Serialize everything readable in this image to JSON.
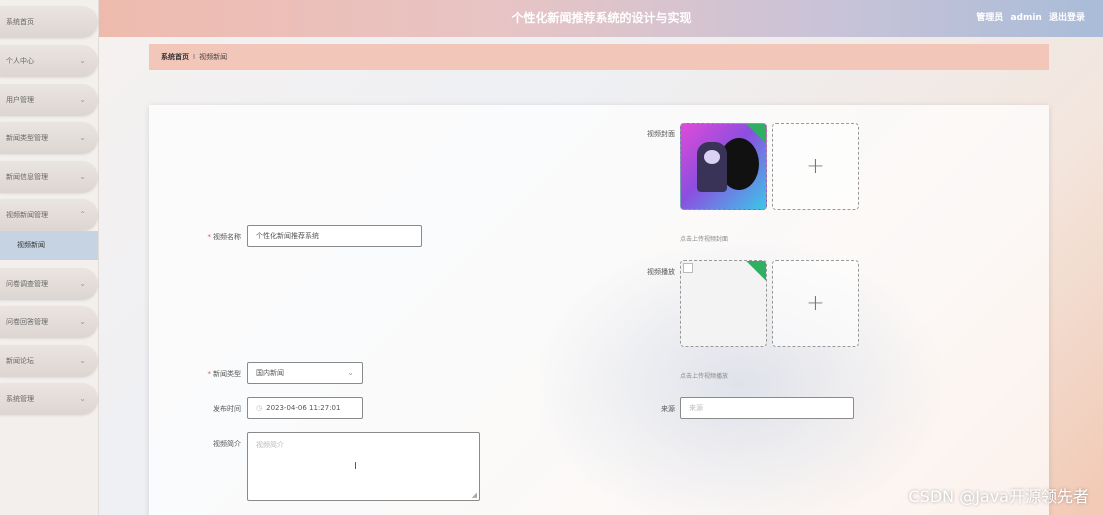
{
  "header": {
    "title": "个性化新闻推荐系统的设计与实现",
    "user_role": "管理员",
    "username": "admin",
    "logout_label": "退出登录"
  },
  "sidebar": {
    "items": [
      {
        "label": "系统首页",
        "chevron": ""
      },
      {
        "label": "个人中心",
        "chevron": "⌄"
      },
      {
        "label": "用户管理",
        "chevron": "⌄"
      },
      {
        "label": "新闻类型管理",
        "chevron": "⌄"
      },
      {
        "label": "新闻信息管理",
        "chevron": "⌄"
      },
      {
        "label": "视频新闻管理",
        "chevron": "⌃"
      },
      {
        "label": "问卷调查管理",
        "chevron": "⌄"
      },
      {
        "label": "问卷回答管理",
        "chevron": "⌄"
      },
      {
        "label": "新闻论坛",
        "chevron": "⌄"
      },
      {
        "label": "系统管理",
        "chevron": "⌄"
      }
    ],
    "active_sub_item": "视频新闻"
  },
  "breadcrumb": {
    "home": "系统首页",
    "separator": "I",
    "current": "视频新闻"
  },
  "form": {
    "video_name": {
      "label": "视频名称",
      "value": "个性化新闻推荐系统"
    },
    "news_type": {
      "label": "新闻类型",
      "value": "国内新闻"
    },
    "publish_time": {
      "label": "发布时间",
      "value": "2023-04-06 11:27:01"
    },
    "intro": {
      "label": "视频简介",
      "placeholder": "视频简介"
    },
    "cover": {
      "label": "视频封面",
      "hint": "点击上传视频封面"
    },
    "video_play": {
      "label": "视频播放",
      "hint": "点击上传视频播放"
    },
    "source": {
      "label": "来源",
      "placeholder": "来源"
    }
  },
  "icons": {
    "clock": "◷",
    "plus": "+",
    "resize_grip": "◢",
    "text_cursor": "I"
  },
  "colors": {
    "required_mark": "#e45656",
    "active_sub_bg": "#c6d3e2",
    "breadcrumb_bg": "#f2c6b8",
    "upload_badge": "#2faf62"
  },
  "watermark": "CSDN @Java开源领先者"
}
